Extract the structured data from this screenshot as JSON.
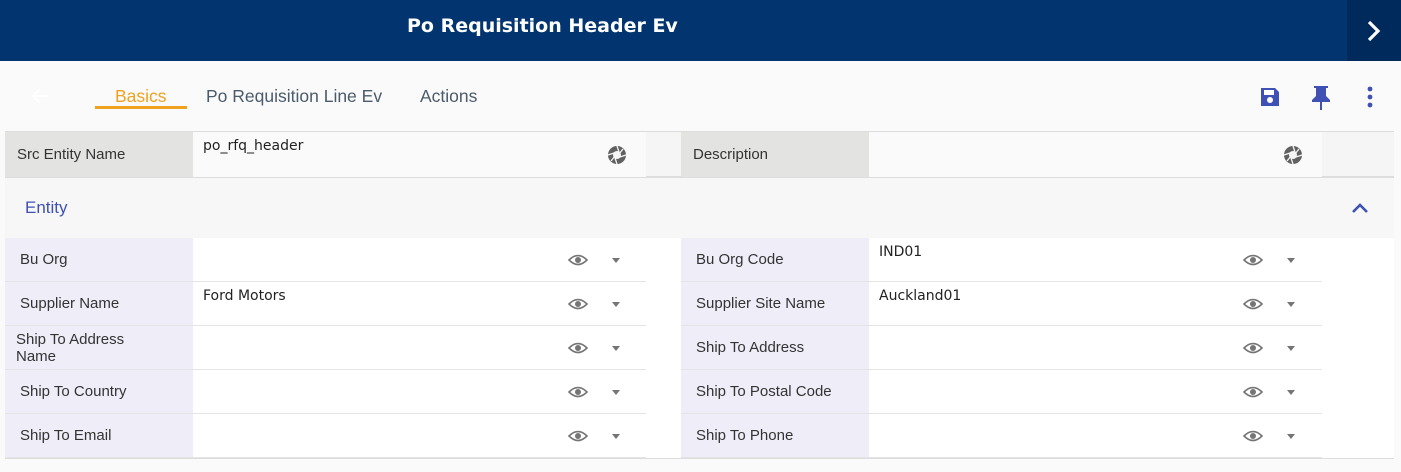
{
  "header": {
    "title": "Po Requisition Header Ev"
  },
  "tabs": [
    {
      "label": "Basics",
      "active": true
    },
    {
      "label": "Po Requisition Line Ev",
      "active": false
    },
    {
      "label": "Actions",
      "active": false
    }
  ],
  "top_fields": [
    {
      "label": "Src Entity Name",
      "value": "po_rfq_header"
    },
    {
      "label": "Description",
      "value": ""
    }
  ],
  "section": {
    "title": "Entity",
    "fields_left": [
      {
        "label": "Bu Org",
        "value": ""
      },
      {
        "label": "Supplier Name",
        "value": "Ford Motors"
      },
      {
        "label": "Ship To Address Name",
        "value": ""
      },
      {
        "label": "Ship To Country",
        "value": ""
      },
      {
        "label": "Ship To Email",
        "value": ""
      }
    ],
    "fields_right": [
      {
        "label": "Bu Org Code",
        "value": "IND01"
      },
      {
        "label": "Supplier Site Name",
        "value": "Auckland01"
      },
      {
        "label": "Ship To Address",
        "value": ""
      },
      {
        "label": "Ship To Postal Code",
        "value": ""
      },
      {
        "label": "Ship To Phone",
        "value": ""
      }
    ]
  },
  "colors": {
    "topbar": "#023470",
    "accent": "#f0a21e",
    "icon": "#3f51b5"
  },
  "icons": [
    "chevron-right-icon",
    "back-arrow-icon",
    "save-icon",
    "pin-icon",
    "more-vert-icon",
    "shutter-icon",
    "eye-icon",
    "caret-down-icon",
    "chevron-up-icon"
  ]
}
